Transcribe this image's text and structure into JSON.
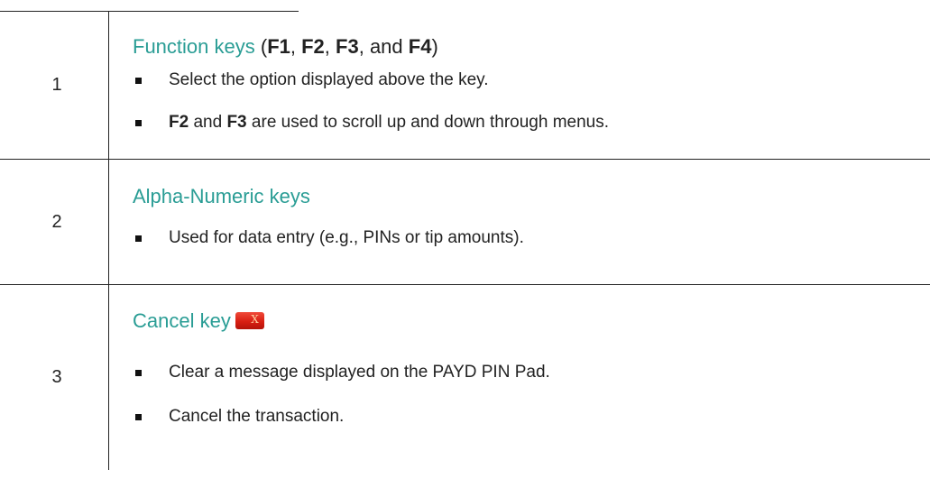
{
  "rows": [
    {
      "number": "1",
      "heading": {
        "prefix": "Function keys",
        "open_paren": " (",
        "k1": "F1",
        "sep1": ", ",
        "k2": "F2",
        "sep2": ", ",
        "k3": "F3",
        "sep3": ", and ",
        "k4": "F4",
        "close_paren": ")"
      },
      "bullets": [
        {
          "text": "Select the option displayed above the key."
        },
        {
          "bold1": "F2",
          "mid": " and ",
          "bold2": "F3",
          "rest": " are used to scroll up and down through menus."
        }
      ]
    },
    {
      "number": "2",
      "heading": "Alpha-Numeric keys",
      "bullets": [
        {
          "text": "Used for data entry (e.g., PINs or tip amounts)."
        }
      ]
    },
    {
      "number": "3",
      "heading": "Cancel key",
      "icon": "cancel-key-icon",
      "bullets": [
        {
          "text": "Clear a message displayed on the PAYD PIN Pad."
        },
        {
          "text": "Cancel the transaction."
        }
      ]
    }
  ],
  "colors": {
    "heading": "#2a9d95",
    "rule": "#222222",
    "cancel_key": "#d81f12"
  }
}
